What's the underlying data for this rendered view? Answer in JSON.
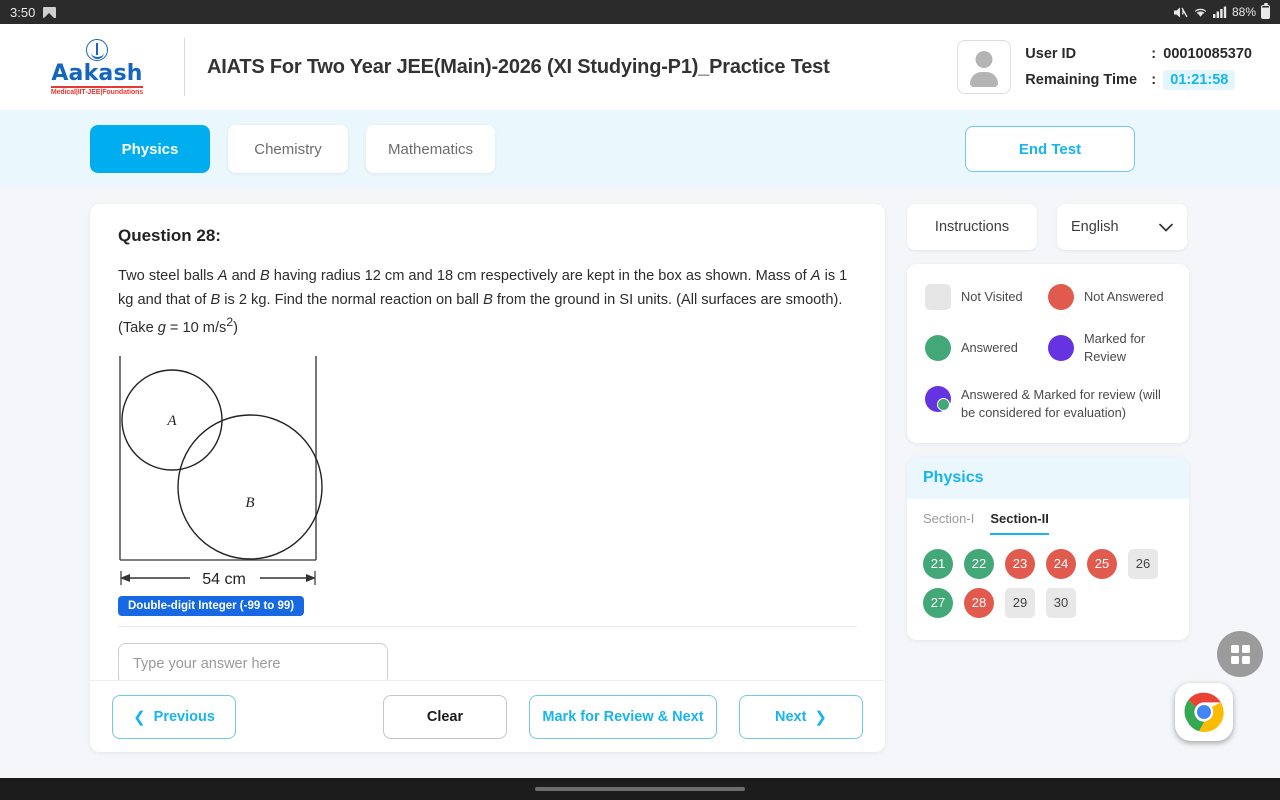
{
  "statusbar": {
    "time": "3:50",
    "screenshot_icon": "screenshot-icon",
    "mute_icon": "mute-icon",
    "wifi_icon": "wifi-icon",
    "signal_icon": "signal-bars-icon",
    "battery_pct": "88%",
    "battery_icon": "battery-icon"
  },
  "header": {
    "logo_name": "Aakash",
    "logo_sub": "Medical|IIT-JEE|Foundations",
    "test_title": "AIATS For Two Year JEE(Main)-2026 (XI Studying-P1)_Practice Test",
    "user_id_label": "User ID",
    "user_id_sep": ":",
    "user_id_value": "00010085370",
    "remaining_label": "Remaining Time",
    "remaining_sep": ":",
    "remaining_value": "01:21:58",
    "avatar_icon": "avatar-icon"
  },
  "tabbar": {
    "tabs": [
      {
        "label": "Physics",
        "active": true
      },
      {
        "label": "Chemistry",
        "active": false
      },
      {
        "label": "Mathematics",
        "active": false
      }
    ],
    "end_test": "End Test"
  },
  "question": {
    "title": "Question 28:",
    "text_parts": {
      "p1": "Two steel balls ",
      "a1": "A",
      "p2": " and ",
      "b1": "B",
      "p3": " having radius 12 cm and 18 cm respectively are kept in the box as shown. Mass of ",
      "a2": "A",
      "p4": " is 1 kg and that of ",
      "b2": "B",
      "p5": " is 2 kg. Find the normal reaction on ball ",
      "b3": "B",
      "p6": " from the ground in SI units. (All surfaces are smooth). (Take ",
      "g": "g",
      "p7": " = 10 m/s",
      "sup": "2",
      "p8": ")"
    },
    "diagram": {
      "ball_a_label": "A",
      "ball_b_label": "B",
      "width_label": "54 cm"
    },
    "type_badge": "Double-digit Integer (-99 to 99)",
    "answer_placeholder": "Type your answer here",
    "answer_value": ""
  },
  "footer": {
    "previous": "Previous",
    "clear": "Clear",
    "mark_review_next": "Mark for Review & Next",
    "next": "Next",
    "prev_icon": "chevron-left-icon",
    "next_icon": "chevron-right-icon"
  },
  "rail": {
    "instructions": "Instructions",
    "language": "English",
    "language_icon": "chevron-down-icon",
    "legend": [
      {
        "label": "Not Visited",
        "style": "square",
        "color": "#e6e6e6"
      },
      {
        "label": "Not Answered",
        "style": "circle",
        "color": "#e05a4e"
      },
      {
        "label": "Answered",
        "style": "circle",
        "color": "#43a878"
      },
      {
        "label": "Marked for Review",
        "style": "circle",
        "color": "#6633e0"
      },
      {
        "label": "Answered & Marked for review (will be considered for evaluation)",
        "style": "combo",
        "color": "#6633e0"
      }
    ],
    "palette": {
      "subject": "Physics",
      "sections": [
        {
          "label": "Section-I",
          "active": false
        },
        {
          "label": "Section-II",
          "active": true
        }
      ],
      "questions": [
        {
          "n": "21",
          "state": "answered"
        },
        {
          "n": "22",
          "state": "answered"
        },
        {
          "n": "23",
          "state": "notanswered"
        },
        {
          "n": "24",
          "state": "notanswered"
        },
        {
          "n": "25",
          "state": "notanswered"
        },
        {
          "n": "26",
          "state": "notvisited"
        },
        {
          "n": "27",
          "state": "answered"
        },
        {
          "n": "28",
          "state": "notanswered"
        },
        {
          "n": "29",
          "state": "notvisited"
        },
        {
          "n": "30",
          "state": "notvisited"
        }
      ]
    }
  },
  "floating": {
    "apps_icon": "apps-grid-icon",
    "chrome_icon": "chrome-icon"
  },
  "navbar": {
    "home_pill": "home-gesture-pill"
  },
  "colors": {
    "accent": "#00aeef",
    "answered": "#43a878",
    "not_answered": "#e05a4e",
    "marked": "#6633e0",
    "not_visited": "#e6e6e6",
    "badge": "#1668e3"
  }
}
